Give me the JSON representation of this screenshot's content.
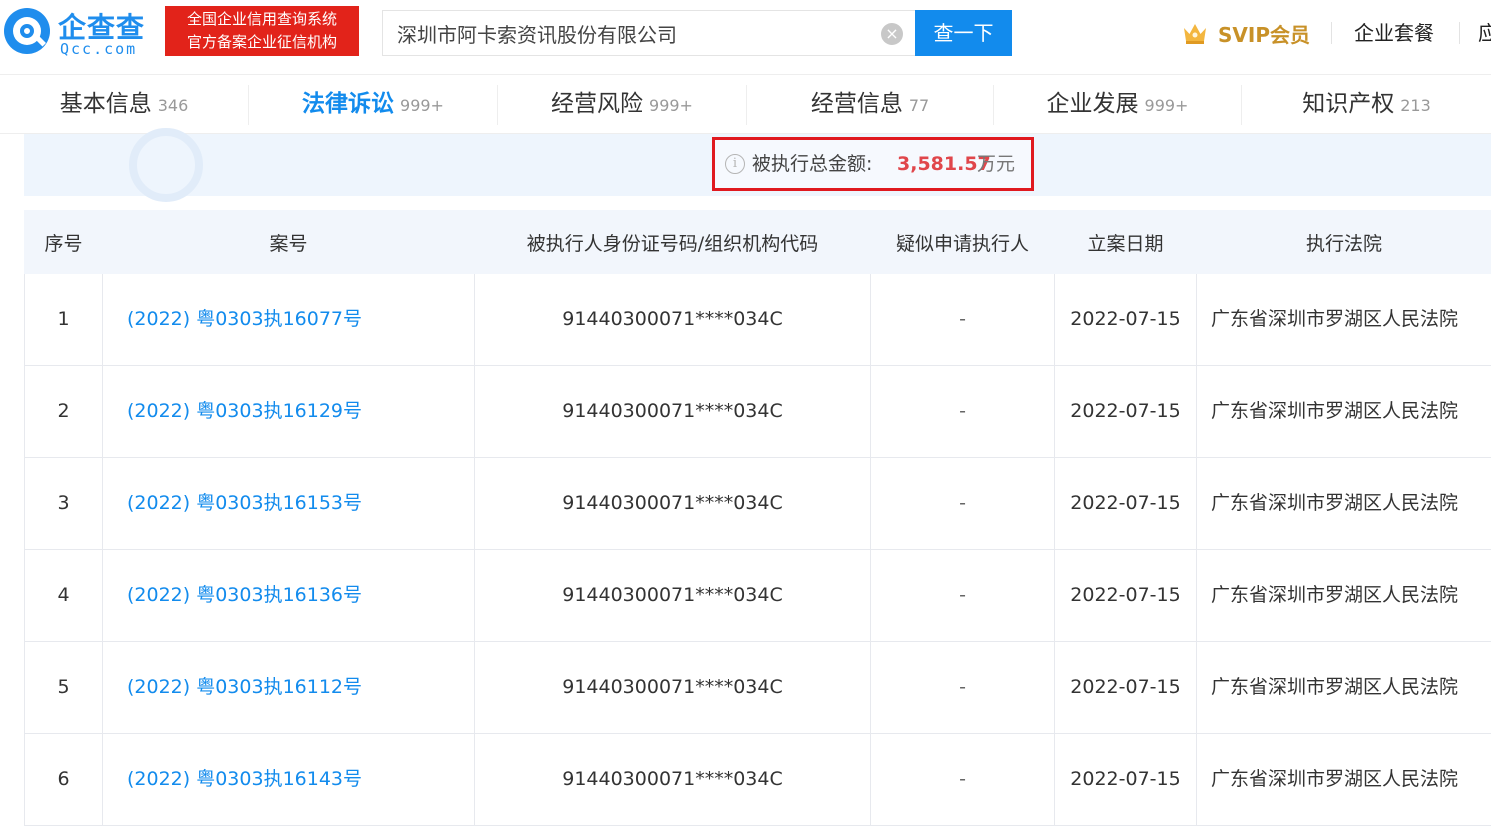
{
  "header": {
    "logo_name": "企查查",
    "logo_domain": "Qcc.com",
    "badge_line1": "全国企业信用查询系统",
    "badge_line2": "官方备案企业征信机构",
    "search_value": "深圳市阿卡索资讯股份有限公司",
    "clear_symbol": "×",
    "search_button": "查一下",
    "svip_label": "SVIP会员",
    "package_label": "企业套餐",
    "truncated_label": "应"
  },
  "tabs": [
    {
      "label": "基本信息",
      "count": "346"
    },
    {
      "label": "法律诉讼",
      "count": "999+"
    },
    {
      "label": "经营风险",
      "count": "999+"
    },
    {
      "label": "经营信息",
      "count": "77"
    },
    {
      "label": "企业发展",
      "count": "999+"
    },
    {
      "label": "知识产权",
      "count": "213"
    }
  ],
  "active_tab": "法律诉讼",
  "summary": {
    "info_symbol": "i",
    "label": "被执行总金额:",
    "value": "3,581.57",
    "unit": "万元"
  },
  "table": {
    "headers": [
      "序号",
      "案号",
      "被执行人身份证号码/组织机构代码",
      "疑似申请执行人",
      "立案日期",
      "执行法院"
    ],
    "rows": [
      {
        "no": "1",
        "case": "(2022) 粤0303执16077号",
        "id": "91440300071****034C",
        "applicant": "-",
        "date": "2022-07-15",
        "court": "广东省深圳市罗湖区人民法院"
      },
      {
        "no": "2",
        "case": "(2022) 粤0303执16129号",
        "id": "91440300071****034C",
        "applicant": "-",
        "date": "2022-07-15",
        "court": "广东省深圳市罗湖区人民法院"
      },
      {
        "no": "3",
        "case": "(2022) 粤0303执16153号",
        "id": "91440300071****034C",
        "applicant": "-",
        "date": "2022-07-15",
        "court": "广东省深圳市罗湖区人民法院"
      },
      {
        "no": "4",
        "case": "(2022) 粤0303执16136号",
        "id": "91440300071****034C",
        "applicant": "-",
        "date": "2022-07-15",
        "court": "广东省深圳市罗湖区人民法院"
      },
      {
        "no": "5",
        "case": "(2022) 粤0303执16112号",
        "id": "91440300071****034C",
        "applicant": "-",
        "date": "2022-07-15",
        "court": "广东省深圳市罗湖区人民法院"
      },
      {
        "no": "6",
        "case": "(2022) 粤0303执16143号",
        "id": "91440300071****034C",
        "applicant": "-",
        "date": "2022-07-15",
        "court": "广东省深圳市罗湖区人民法院"
      }
    ]
  },
  "colors": {
    "brand_blue": "#128bed",
    "badge_red": "#e2231a",
    "highlight_red": "#e0191f",
    "amount_red": "#e0464b",
    "svip_gold": "#c89128"
  }
}
